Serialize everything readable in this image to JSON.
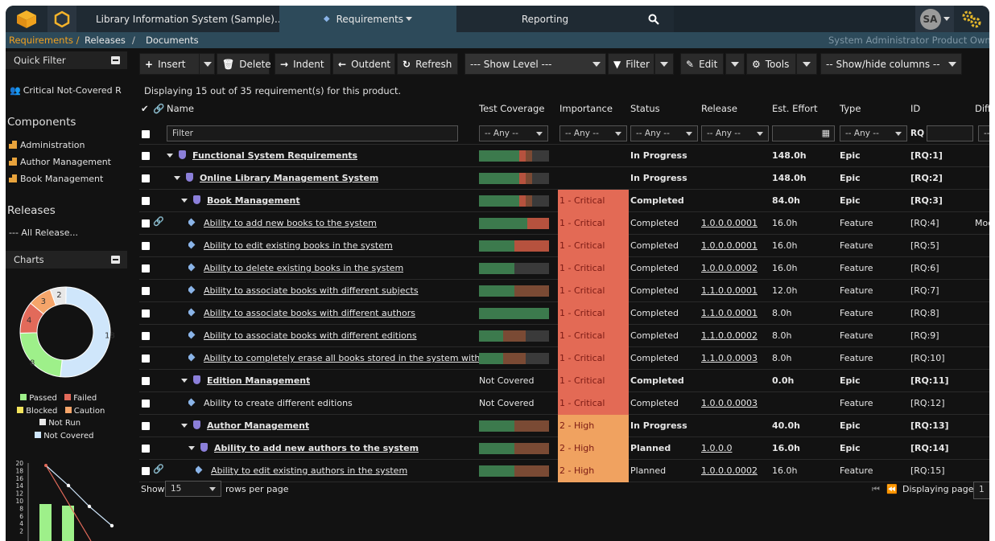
{
  "topbar": {
    "product_title": "Library Information System (Sample)...",
    "nav_requirements": "Requirements",
    "nav_reporting": "Reporting",
    "user_initials": "SA"
  },
  "breadcrumb": {
    "requirements": "Requirements /",
    "releases": "Releases",
    "sep": "/",
    "documents": "Documents",
    "role": "System Administrator  Product Owner"
  },
  "sidebar": {
    "quick_filter_header": "Quick Filter",
    "quick_filter_item": "Critical Not-Covered R",
    "components_header": "Components",
    "components": [
      "Administration",
      "Author Management",
      "Book Management"
    ],
    "releases_header": "Releases",
    "releases_value": "--- All Release...",
    "charts_header": "Charts",
    "donut": {
      "values": [
        {
          "label": "Not Covered",
          "value": 18,
          "color": "#cfe6fb"
        },
        {
          "label": "Passed",
          "value": 8,
          "color": "#9ef08a"
        },
        {
          "label": "Failed",
          "value": 4,
          "color": "#e26a5a"
        },
        {
          "label": "Caution",
          "value": 3,
          "color": "#f5a56a"
        },
        {
          "label": "Not Run",
          "value": 2,
          "color": "#e8e8e8"
        }
      ]
    },
    "legend": [
      "Passed",
      "Failed",
      "Blocked",
      "Caution",
      "Not Run",
      "Not Covered"
    ],
    "mini_chart_ticks": [
      "20",
      "18",
      "16",
      "14",
      "12",
      "10",
      "8",
      "6",
      "4",
      "2"
    ]
  },
  "toolbar": {
    "insert": "Insert",
    "delete": "Delete",
    "indent": "Indent",
    "outdent": "Outdent",
    "refresh": "Refresh",
    "show_level": "--- Show Level ---",
    "filter": "Filter",
    "edit": "Edit",
    "tools": "Tools",
    "show_hide": "-- Show/hide columns --"
  },
  "table": {
    "summary": "Displaying 15 out of 35 requirement(s) for this product.",
    "headers": {
      "name": "Name",
      "coverage": "Test Coverage",
      "importance": "Importance",
      "status": "Status",
      "release": "Release",
      "effort": "Est. Effort",
      "type": "Type",
      "id": "ID",
      "difficulty": "Diffic"
    },
    "filters": {
      "name": "Filter",
      "any": "-- Any --",
      "id_prefix": "RQ",
      "diff": "-- A"
    },
    "rows": [
      {
        "name": "Functional System Requirements",
        "indent": 0,
        "kind": "epic",
        "link": true,
        "coverage": [
          [
            50,
            "#3c7a4d"
          ],
          [
            8,
            "#b6523e"
          ],
          [
            8,
            "#7a4a34"
          ],
          [
            21,
            "#3a3a3a"
          ]
        ],
        "importance": "",
        "status": "In Progress",
        "release": "",
        "effort": "148.0h",
        "type": "Epic",
        "id": "[RQ:1]",
        "bold": true,
        "diff": ""
      },
      {
        "name": "Online Library Management System",
        "indent": 1,
        "kind": "epic",
        "link": true,
        "coverage": [
          [
            50,
            "#3c7a4d"
          ],
          [
            8,
            "#b6523e"
          ],
          [
            8,
            "#7a4a34"
          ],
          [
            21,
            "#3a3a3a"
          ]
        ],
        "importance": "",
        "status": "In Progress",
        "release": "",
        "effort": "148.0h",
        "type": "Epic",
        "id": "[RQ:2]",
        "bold": true,
        "diff": ""
      },
      {
        "name": "Book Management",
        "indent": 2,
        "kind": "epic",
        "link": true,
        "coverage": [
          [
            50,
            "#3c7a4d"
          ],
          [
            8,
            "#b6523e"
          ],
          [
            8,
            "#7a4a34"
          ],
          [
            21,
            "#3a3a3a"
          ]
        ],
        "importance": "1 - Critical",
        "status": "Completed",
        "release": "",
        "effort": "84.0h",
        "type": "Epic",
        "id": "[RQ:3]",
        "bold": true,
        "diff": ""
      },
      {
        "name": "Ability to add new books to the system",
        "indent": 3,
        "kind": "feat",
        "link": true,
        "attach": true,
        "coverage": [
          [
            60,
            "#3c7a4d"
          ],
          [
            27,
            "#b6523e"
          ]
        ],
        "importance": "1 - Critical",
        "status": "Completed",
        "release": "1.0.0.0.0001",
        "effort": "16.0h",
        "type": "Feature",
        "id": "[RQ:4]",
        "bold": false,
        "diff": "Mode"
      },
      {
        "name": "Ability to edit existing books in the system",
        "indent": 3,
        "kind": "feat",
        "link": true,
        "coverage": [
          [
            44,
            "#3c7a4d"
          ],
          [
            43,
            "#b6523e"
          ]
        ],
        "importance": "1 - Critical",
        "status": "Completed",
        "release": "1.0.0.0.0001",
        "effort": "16.0h",
        "type": "Feature",
        "id": "[RQ:5]",
        "bold": false,
        "diff": ""
      },
      {
        "name": "Ability to delete existing books in the system",
        "indent": 3,
        "kind": "feat",
        "link": true,
        "coverage": [
          [
            44,
            "#3c7a4d"
          ],
          [
            43,
            "#3a3a3a"
          ]
        ],
        "importance": "1 - Critical",
        "status": "Completed",
        "release": "1.0.0.0.0002",
        "effort": "16.0h",
        "type": "Feature",
        "id": "[RQ:6]",
        "bold": false,
        "diff": ""
      },
      {
        "name": "Ability to associate books with different subjects",
        "indent": 3,
        "kind": "feat",
        "link": true,
        "coverage": [
          [
            44,
            "#3c7a4d"
          ],
          [
            43,
            "#7a4a34"
          ]
        ],
        "importance": "1 - Critical",
        "status": "Completed",
        "release": "1.1.0.0.0001",
        "effort": "12.0h",
        "type": "Feature",
        "id": "[RQ:7]",
        "bold": false,
        "diff": ""
      },
      {
        "name": "Ability to associate books with different authors",
        "indent": 3,
        "kind": "feat",
        "link": true,
        "coverage": [
          [
            87,
            "#3c7a4d"
          ]
        ],
        "importance": "1 - Critical",
        "status": "Completed",
        "release": "1.1.0.0.0001",
        "effort": "8.0h",
        "type": "Feature",
        "id": "[RQ:8]",
        "bold": false,
        "diff": ""
      },
      {
        "name": "Ability to associate books with different editions",
        "indent": 3,
        "kind": "feat",
        "link": true,
        "coverage": [
          [
            30,
            "#3c7a4d"
          ],
          [
            28,
            "#7a4a34"
          ],
          [
            29,
            "#3a3a3a"
          ]
        ],
        "importance": "1 - Critical",
        "status": "Completed",
        "release": "1.1.0.0.0002",
        "effort": "8.0h",
        "type": "Feature",
        "id": "[RQ:9]",
        "bold": false,
        "diff": ""
      },
      {
        "name": "Ability to completely erase all books stored in the system with",
        "indent": 3,
        "kind": "feat",
        "link": true,
        "coverage": [
          [
            30,
            "#3c7a4d"
          ],
          [
            28,
            "#7a4a34"
          ],
          [
            29,
            "#3a3a3a"
          ]
        ],
        "importance": "1 - Critical",
        "status": "Completed",
        "release": "1.1.0.0.0003",
        "effort": "8.0h",
        "type": "Feature",
        "id": "[RQ:10]",
        "bold": false,
        "diff": ""
      },
      {
        "name": "Edition Management",
        "indent": 2,
        "kind": "epic",
        "link": true,
        "coverage": [],
        "cov_text": "Not Covered",
        "importance": "1 - Critical",
        "status": "Completed",
        "release": "",
        "effort": "0.0h",
        "type": "Epic",
        "id": "[RQ:11]",
        "bold": true,
        "diff": ""
      },
      {
        "name": "Ability to create different editions",
        "indent": 3,
        "kind": "feat",
        "link": false,
        "coverage": [],
        "cov_text": "Not Covered",
        "importance": "1 - Critical",
        "status": "Completed",
        "release": "1.0.0.0.0003",
        "effort": "",
        "type": "Feature",
        "id": "[RQ:12]",
        "bold": false,
        "diff": ""
      },
      {
        "name": "Author Management",
        "indent": 2,
        "kind": "epic",
        "link": true,
        "coverage": [
          [
            44,
            "#3c7a4d"
          ],
          [
            43,
            "#7a4a34"
          ]
        ],
        "importance": "2 - High",
        "status": "In Progress",
        "release": "",
        "effort": "40.0h",
        "type": "Epic",
        "id": "[RQ:13]",
        "bold": true,
        "diff": ""
      },
      {
        "name": "Ability to add new authors to the system",
        "indent": 3,
        "kind": "epic",
        "link": true,
        "coverage": [
          [
            44,
            "#3c7a4d"
          ],
          [
            43,
            "#7a4a34"
          ]
        ],
        "importance": "2 - High",
        "status": "Planned",
        "release": "1.0.0.0",
        "effort": "16.0h",
        "type": "Epic",
        "id": "[RQ:14]",
        "bold": true,
        "diff": ""
      },
      {
        "name": "Ability to edit existing authors in the system",
        "indent": 4,
        "kind": "feat",
        "link": true,
        "attach": true,
        "coverage": [
          [
            44,
            "#3c7a4d"
          ],
          [
            43,
            "#7a4a34"
          ]
        ],
        "importance": "2 - High",
        "status": "Planned",
        "release": "1.0.0.0.0002",
        "effort": "16.0h",
        "type": "Feature",
        "id": "[RQ:15]",
        "bold": false,
        "diff": ""
      }
    ]
  },
  "footer": {
    "show": "Show",
    "page_size": "15",
    "rows_per_page": "rows per page",
    "displaying_page": "Displaying page",
    "page_num": "1"
  },
  "colors": {
    "critical": "#e36a55",
    "high": "#f0a260",
    "topbar": "#1f2a33",
    "breadcrumb_active": "#f0a020"
  }
}
